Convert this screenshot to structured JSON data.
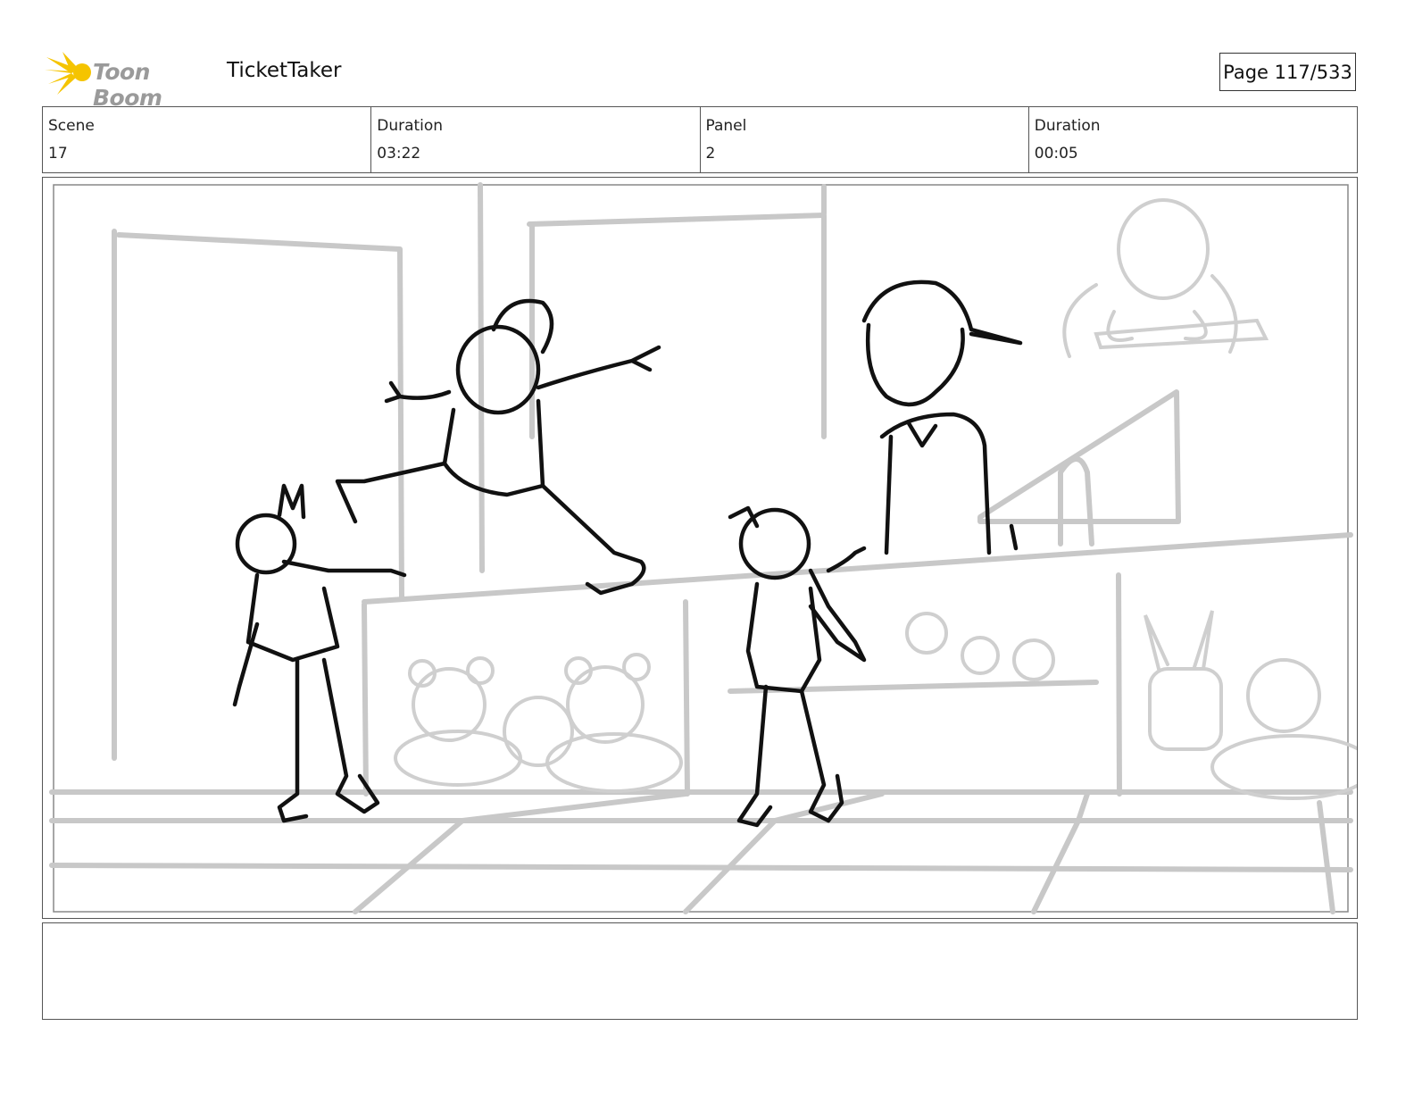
{
  "header": {
    "logo_text": "Toon Boom",
    "project_title": "TicketTaker",
    "page_label": "Page 117/533",
    "accent_color": "#f5c400"
  },
  "info": {
    "scene_label": "Scene",
    "scene_value": "17",
    "scene_duration_label": "Duration",
    "scene_duration_value": "03:22",
    "panel_label": "Panel",
    "panel_value": "2",
    "panel_duration_label": "Duration",
    "panel_duration_value": "00:05"
  },
  "notes": {
    "text": ""
  }
}
